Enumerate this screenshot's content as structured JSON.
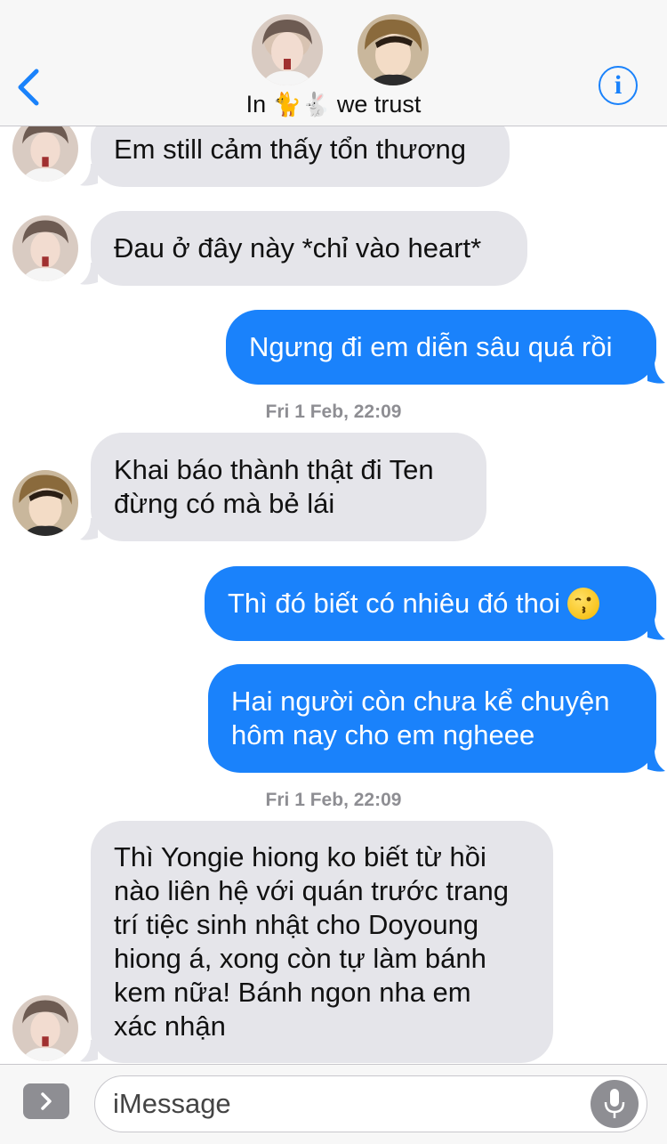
{
  "header": {
    "title_prefix": "In",
    "title_emoji": "🐈🐇",
    "title_suffix": "we trust",
    "back_icon": "chevron-left-icon",
    "info_icon": "info-icon",
    "info_glyph": "i",
    "accent_color": "#1a82fb"
  },
  "messages": [
    {
      "side": "in",
      "text": "Em still cảm thấy tổn thương"
    },
    {
      "side": "in",
      "text": "Đau ở đây này *chỉ vào heart*"
    },
    {
      "side": "out",
      "text": "Ngưng đi em diễn sâu quá rồi"
    },
    {
      "type": "timestamp",
      "text": "Fri 1 Feb, 22:09"
    },
    {
      "side": "in",
      "text": "Khai báo thành thật đi Ten\nđừng có mà bẻ lái"
    },
    {
      "side": "out",
      "text": "Thì đó biết có nhiêu đó thoi",
      "emoji": "kissing-face-emoji"
    },
    {
      "side": "out",
      "text": "Hai người còn chưa kể chuyện\nhôm nay cho em ngheee"
    },
    {
      "type": "timestamp",
      "text": "Fri 1 Feb, 22:09"
    },
    {
      "side": "in",
      "text": "Thì Yongie hiong ko biết từ hồi\nnào liên hệ với quán trước trang\ntrí tiệc sinh nhật cho Doyoung\nhiong á, xong còn tự làm bánh\nkem nữa! Bánh ngon nha em\nxác nhận"
    }
  ],
  "input": {
    "placeholder": "iMessage",
    "value": "",
    "apps_icon": "chevron-right-icon",
    "mic_icon": "microphone-icon"
  },
  "colors": {
    "outgoing_bubble": "#1a82fb",
    "incoming_bubble": "#e5e5ea",
    "timestamp_text": "#8e8e93"
  }
}
